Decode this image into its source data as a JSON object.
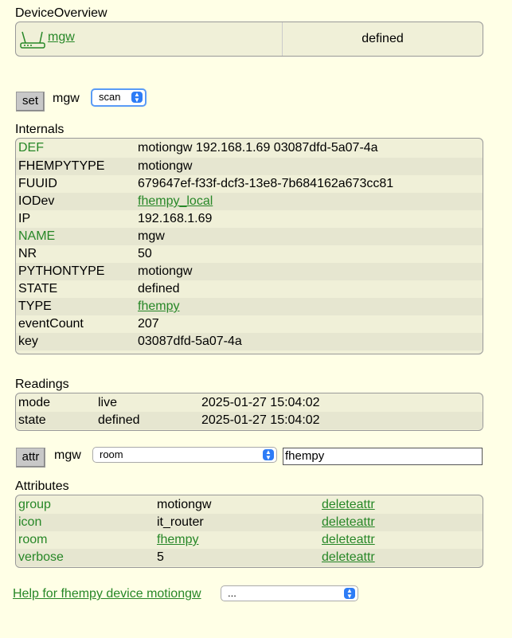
{
  "overview": {
    "title": "DeviceOverview",
    "device_name": "mgw",
    "device_state": "defined",
    "device_icon": "router-icon"
  },
  "set_command": {
    "button_label": "set",
    "device": "mgw",
    "selected": "scan"
  },
  "internals": {
    "title": "Internals",
    "rows": [
      {
        "key": "DEF",
        "value": "motiongw 192.168.1.69 03087dfd-5a07-4a"
      },
      {
        "key": "FHEMPYTYPE",
        "value": "motiongw"
      },
      {
        "key": "FUUID",
        "value": "679647ef-f33f-dcf3-13e8-7b684162a673cc81"
      },
      {
        "key": "IODev",
        "value": "fhempy_local"
      },
      {
        "key": "IP",
        "value": "192.168.1.69"
      },
      {
        "key": "NAME",
        "value": "mgw"
      },
      {
        "key": "NR",
        "value": "50"
      },
      {
        "key": "PYTHONTYPE",
        "value": "motiongw"
      },
      {
        "key": "STATE",
        "value": "defined"
      },
      {
        "key": "TYPE",
        "value": "fhempy"
      },
      {
        "key": "eventCount",
        "value": "207"
      },
      {
        "key": "key",
        "value": "03087dfd-5a07-4a"
      }
    ]
  },
  "readings": {
    "title": "Readings",
    "rows": [
      {
        "name": "mode",
        "value": "live",
        "time": "2025-01-27 15:04:02"
      },
      {
        "name": "state",
        "value": "defined",
        "time": "2025-01-27 15:04:02"
      }
    ]
  },
  "attr_command": {
    "button_label": "attr",
    "device": "mgw",
    "selected": "room",
    "value": "fhempy"
  },
  "attributes": {
    "title": "Attributes",
    "delete_label": "deleteattr",
    "rows": [
      {
        "name": "group",
        "value": "motiongw"
      },
      {
        "name": "icon",
        "value": "it_router"
      },
      {
        "name": "room",
        "value": "fhempy"
      },
      {
        "name": "verbose",
        "value": "5"
      }
    ]
  },
  "footer": {
    "help_link": "Help for fhempy device motiongw",
    "select_value": "..."
  },
  "colors": {
    "background": "#FFFFE6",
    "link": "#278727",
    "row": "#F0F0D8",
    "row_alt": "#E6E6D0",
    "select_arrow": "#2D7CF6"
  }
}
